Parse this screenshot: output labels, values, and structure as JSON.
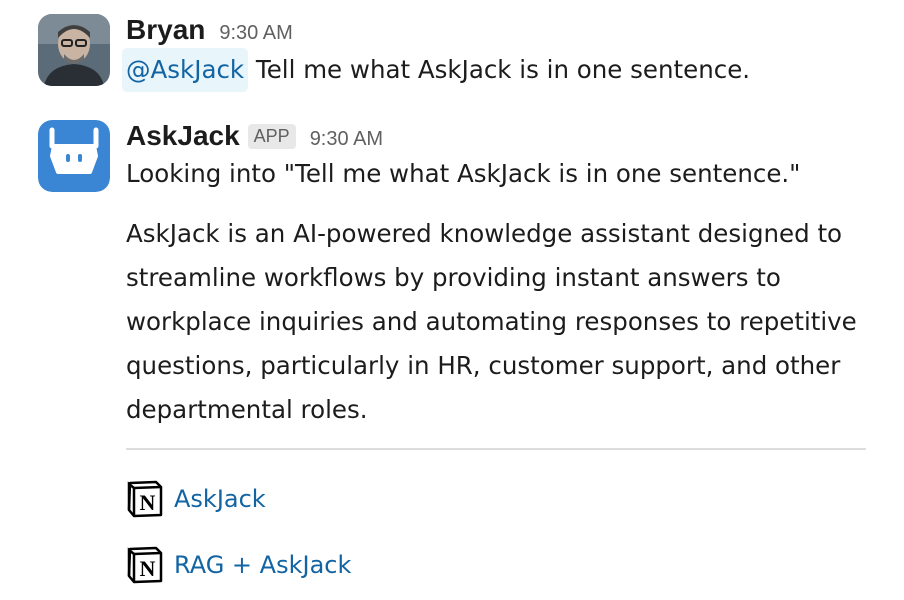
{
  "messages": [
    {
      "sender": "Bryan",
      "time": "9:30 AM",
      "mention": "@AskJack",
      "text": " Tell me what AskJack is in one sentence."
    },
    {
      "sender": "AskJack",
      "badge": "APP",
      "time": "9:30 AM",
      "status": "Looking into \"Tell me what AskJack is in one sentence.\"",
      "answer": "AskJack is an AI-powered knowledge assistant designed to streamline workflows by providing instant answers to workplace inquiries and automating responses to repetitive questions, particularly in HR, customer support, and other departmental roles.",
      "sources": [
        {
          "label": "AskJack",
          "icon": "notion-icon"
        },
        {
          "label": "RAG + AskJack",
          "icon": "notion-icon"
        }
      ]
    }
  ],
  "colors": {
    "link": "#1264a3",
    "mention_bg": "#e8f5fa",
    "bot_avatar_bg": "#3a86d4",
    "text": "#1d1c1d",
    "muted": "#616061"
  }
}
